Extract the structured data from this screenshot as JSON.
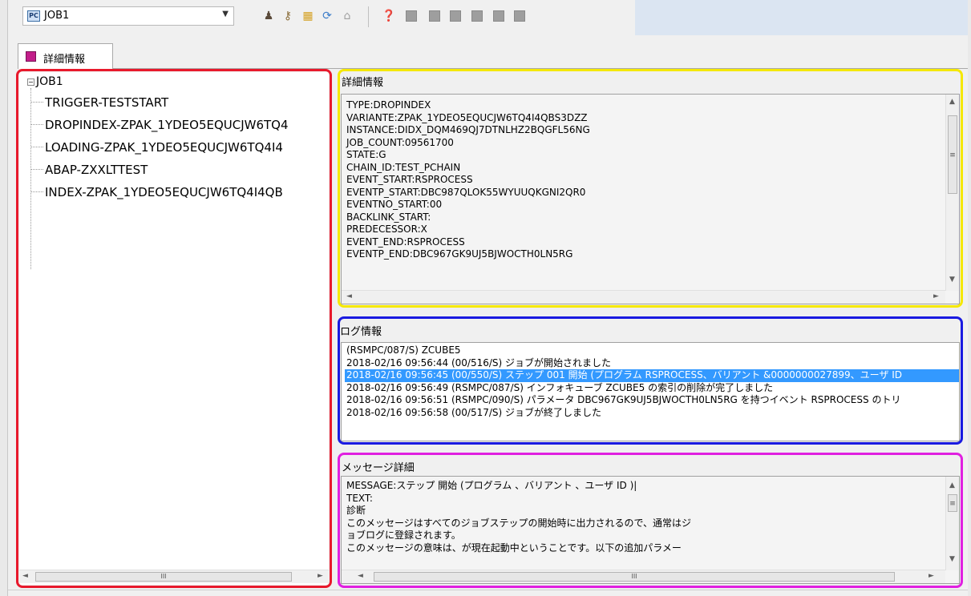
{
  "toolbar": {
    "job_select_value": "JOB1",
    "job_select_icon": "PC",
    "icons": [
      "user-icon",
      "key-icon",
      "grid-icon",
      "refresh-icon",
      "home-icon",
      "help-icon",
      "document-icon",
      "document-stack-icon",
      "document-edit-icon",
      "job-icon",
      "job-export-icon",
      "square-icon"
    ]
  },
  "tab": {
    "label": "詳細情報"
  },
  "tree": {
    "root": "JOB1",
    "items": [
      "TRIGGER-TESTSTART",
      "DROPINDEX-ZPAK_1YDEO5EQUCJW6TQ4",
      "LOADING-ZPAK_1YDEO5EQUCJW6TQ4I4",
      "ABAP-ZXXLTTEST",
      "INDEX-ZPAK_1YDEO5EQUCJW6TQ4I4QB"
    ]
  },
  "detail": {
    "title": "詳細情報",
    "lines": [
      "TYPE:DROPINDEX",
      "VARIANTE:ZPAK_1YDEO5EQUCJW6TQ4I4QBS3DZZ",
      "INSTANCE:DIDX_DQM469QJ7DTNLHZ2BQGFL56NG",
      "JOB_COUNT:09561700",
      "STATE:G",
      "CHAIN_ID:TEST_PCHAIN",
      "EVENT_START:RSPROCESS",
      "EVENTP_START:DBC987QLOK55WYUUQKGNI2QR0",
      "EVENTNO_START:00",
      "BACKLINK_START:",
      "PREDECESSOR:X",
      "EVENT_END:RSPROCESS",
      "EVENTP_END:DBC967GK9UJ5BJWOCTH0LN5RG"
    ]
  },
  "log": {
    "title": "ログ情報",
    "selected_index": 2,
    "lines": [
      "(RSMPC/087/S) ZCUBE5",
      "2018-02/16 09:56:44 (00/516/S) ジョブが開始されました",
      "2018-02/16 09:56:45 (00/550/S) ステップ 001 開始 (プログラム RSPROCESS、バリアント &0000000027899、ユーザ ID",
      "2018-02/16 09:56:49 (RSMPC/087/S) インフォキューブ ZCUBE5 の索引の削除が完了しました",
      "2018-02/16 09:56:51 (RSMPC/090/S) パラメータ DBC967GK9UJ5BJWOCTH0LN5RG を持つイベント RSPROCESS のトリ",
      "2018-02/16 09:56:58 (00/517/S) ジョブが終了しました"
    ]
  },
  "message": {
    "title": "メッセージ詳細",
    "lines": [
      "MESSAGE:ステップ 開始 (プログラム 、バリアント 、ユーザ ID )|",
      "TEXT:",
      "診断",
      "このメッセージはすべてのジョブステップの開始時に出力されるので、通常はジ",
      "ョブログに登録されます。",
      "このメッセージの意味は、が現在起動中ということです。以下の追加パラメー"
    ]
  },
  "scrollbar": {
    "thumb_grip": "III",
    "vthumb_grip": "≡"
  },
  "colors": {
    "highlight_tree": "#e8192c",
    "highlight_detail": "#f5e800",
    "highlight_log": "#1a1ae0",
    "highlight_message": "#e020e0",
    "selection": "#3399ff"
  }
}
